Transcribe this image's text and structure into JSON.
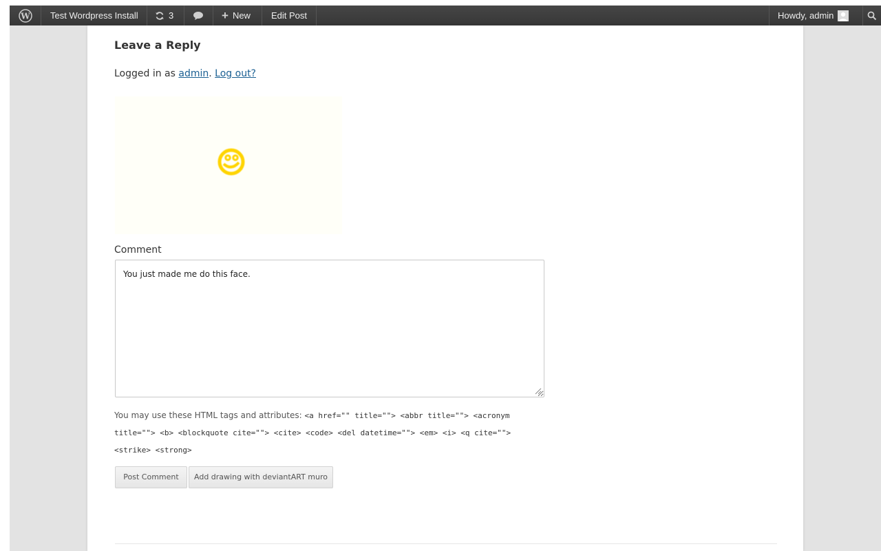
{
  "adminbar": {
    "wp_logo_icon": "wordpress-logo-icon",
    "site_name": "Test Wordpress Install",
    "updates_count": "3",
    "updates_icon": "refresh-icon",
    "comments_icon": "comment-bubble-icon",
    "new_label": "New",
    "new_icon": "plus-icon",
    "edit_post_label": "Edit Post",
    "howdy_label": "Howdy, admin",
    "avatar_icon": "user-avatar-icon",
    "search_icon": "search-icon"
  },
  "reply": {
    "title": "Leave a Reply",
    "logged_in_prefix": "Logged in as ",
    "user_link": "admin",
    "separator": ".",
    "logout_link": "Log out?",
    "drawing_icon": "smiley-face-drawing"
  },
  "comment": {
    "label": "Comment",
    "value": "You just made me do this face.",
    "allowed_tags_prefix": "You may use these HTML tags and attributes: ",
    "allowed_tags_code": "<a href=\"\" title=\"\"> <abbr title=\"\"> <acronym title=\"\"> <b> <blockquote cite=\"\"> <cite> <code> <del datetime=\"\"> <em> <i> <q cite=\"\"> <strike> <strong>"
  },
  "buttons": {
    "post_comment": "Post Comment",
    "add_drawing": "Add drawing with deviantART muro"
  },
  "colors": {
    "adminbar_bg": "#373737",
    "link": "#1a5f92",
    "drawing_bg": "#fffff8",
    "smiley": "#ffd400"
  }
}
